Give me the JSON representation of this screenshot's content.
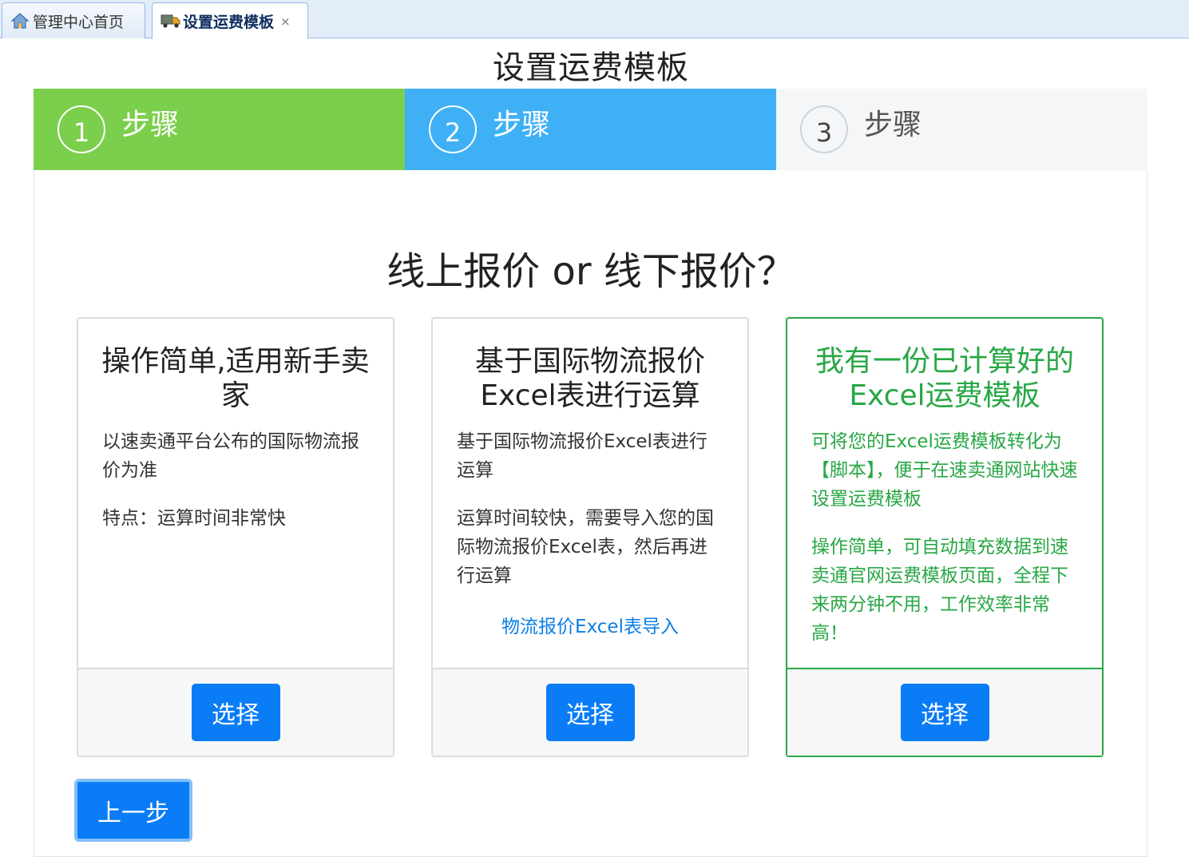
{
  "tabs": [
    {
      "label": "管理中心首页",
      "icon": "home-icon"
    },
    {
      "label": "设置运费模板",
      "icon": "truck-icon",
      "close": "×"
    }
  ],
  "page": {
    "title": "设置运费模板"
  },
  "steps": [
    {
      "number": "1",
      "label": "步骤",
      "color": "#7ccf4c"
    },
    {
      "number": "2",
      "label": "步骤",
      "color": "#3fb0f6"
    },
    {
      "number": "3",
      "label": "步骤",
      "color": "#f4f6f8"
    }
  ],
  "question": "线上报价 or  线下报价？",
  "cards": [
    {
      "title": "操作简单,适用新手卖家",
      "desc": "以速卖通平台公布的国际物流报价为准",
      "desc2": "特点：运算时间非常快",
      "button": "选择"
    },
    {
      "title": "基于国际物流报价Excel表进行运算",
      "desc": "基于国际物流报价Excel表进行运算",
      "desc2": "运算时间较快，需要导入您的国际物流报价Excel表，然后再进行运算",
      "link": "物流报价Excel表导入",
      "button": "选择"
    },
    {
      "title": "我有一份已计算好的Excel运费模板",
      "desc": "可将您的Excel运费模板转化为【脚本】，便于在速卖通网站快速设置运费模板",
      "desc2": "操作简单，可自动填充数据到速卖通官网运费模板页面，全程下来两分钟不用，工作效率非常高！",
      "button": "选择"
    }
  ],
  "prev_button": "上一步",
  "colors": {
    "accent": "#0a7cf6",
    "success": "#28a745",
    "link": "#0b7ee6"
  }
}
